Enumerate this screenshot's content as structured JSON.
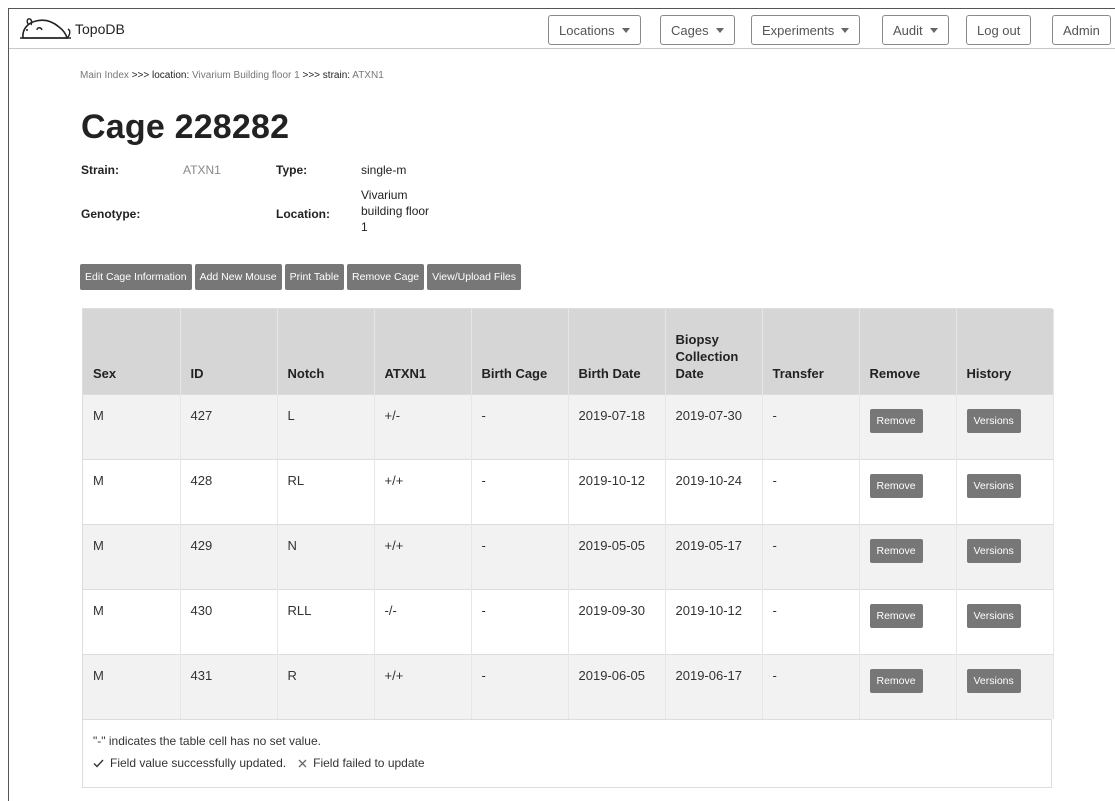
{
  "app": {
    "name": "TopoDB"
  },
  "nav": {
    "locations": "Locations",
    "cages": "Cages",
    "experiments": "Experiments",
    "audit": "Audit",
    "logout": "Log out",
    "admin": "Admin"
  },
  "breadcrumb": {
    "main": "Main Index",
    "sep": ">>>",
    "location_key": "location:",
    "location_val": "Vivarium Building floor 1",
    "strain_key": "strain:",
    "strain_val": "ATXN1"
  },
  "cage": {
    "title": "Cage 228282",
    "strain_label": "Strain:",
    "strain": "ATXN1",
    "type_label": "Type:",
    "type": "single-m",
    "genotype_label": "Genotype:",
    "genotype": "",
    "location_label": "Location:",
    "location_lines": [
      "Vivarium",
      "building floor",
      "1"
    ]
  },
  "actions": {
    "edit": "Edit Cage Information",
    "add_mouse": "Add New Mouse",
    "print": "Print Table",
    "remove_cage": "Remove Cage",
    "files": "View/Upload Files"
  },
  "table": {
    "headers": [
      "Sex",
      "ID",
      "Notch",
      "ATXN1",
      "Birth Cage",
      "Birth Date",
      "Biopsy Collection Date",
      "Transfer",
      "Remove",
      "History"
    ],
    "remove_label": "Remove",
    "versions_label": "Versions",
    "rows": [
      {
        "sex": "M",
        "id": "427",
        "notch": "L",
        "atxn1": "+/-",
        "birth_cage": "-",
        "birth_date": "2019-07-18",
        "biopsy": "2019-07-30",
        "transfer": "-"
      },
      {
        "sex": "M",
        "id": "428",
        "notch": "RL",
        "atxn1": "+/+",
        "birth_cage": "-",
        "birth_date": "2019-10-12",
        "biopsy": "2019-10-24",
        "transfer": "-"
      },
      {
        "sex": "M",
        "id": "429",
        "notch": "N",
        "atxn1": "+/+",
        "birth_cage": "-",
        "birth_date": "2019-05-05",
        "biopsy": "2019-05-17",
        "transfer": "-"
      },
      {
        "sex": "M",
        "id": "430",
        "notch": "RLL",
        "atxn1": "-/-",
        "birth_cage": "-",
        "birth_date": "2019-09-30",
        "biopsy": "2019-10-12",
        "transfer": "-"
      },
      {
        "sex": "M",
        "id": "431",
        "notch": "R",
        "atxn1": "+/+",
        "birth_cage": "-",
        "birth_date": "2019-06-05",
        "biopsy": "2019-06-17",
        "transfer": "-"
      }
    ]
  },
  "legend": {
    "note": "\"-\" indicates the table cell has no set value.",
    "success_icon": "check-icon",
    "success": "Field value successfully updated.",
    "fail_icon": "x-icon",
    "fail": "Field failed to update"
  }
}
